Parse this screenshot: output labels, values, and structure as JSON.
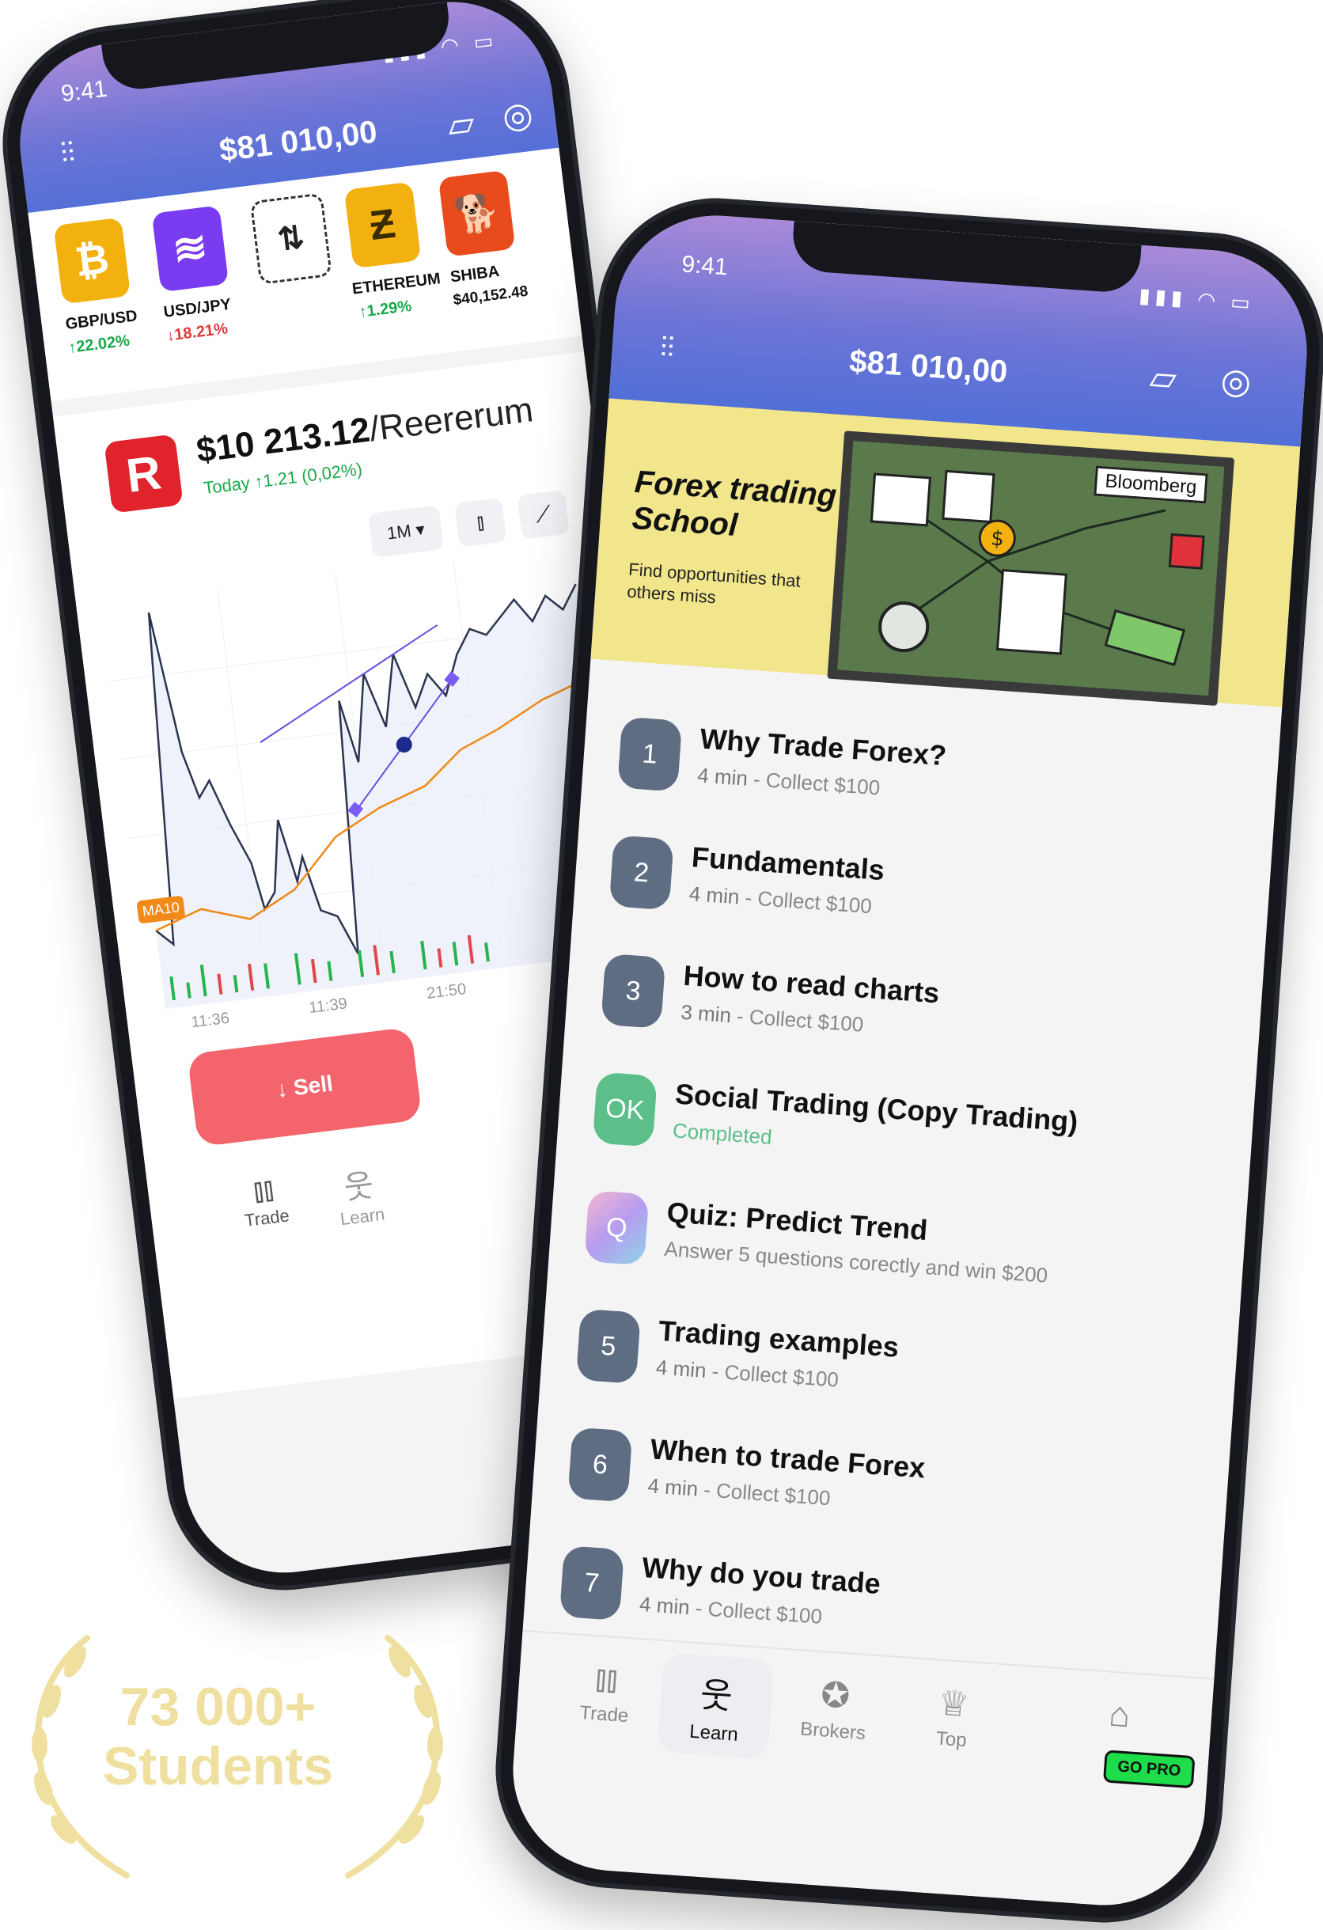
{
  "left_phone": {
    "status_time": "9:41",
    "balance": "$81 010,00",
    "coins": [
      {
        "pair": "GBP/USD",
        "change": "↑22.02%",
        "dir": "up",
        "color": "#f3b10f",
        "glyph": "₿"
      },
      {
        "pair": "USD/JPY",
        "change": "↓18.21%",
        "dir": "down",
        "color": "#7a3cf0",
        "glyph": "≋"
      },
      {
        "pair": "",
        "change": "",
        "dir": "",
        "color": "#ffffff",
        "glyph": "⇅"
      },
      {
        "pair": "ETHEREUM",
        "change": "↑1.29%",
        "dir": "up",
        "color": "#f3b10f",
        "glyph": "Ƶ"
      },
      {
        "pair": "SHIBA",
        "change": "$40,152.48",
        "dir": "",
        "color": "#e84b1c",
        "glyph": "🐕"
      }
    ],
    "asset_logo": "R",
    "price": "$10 213.12",
    "price_name": "/Reererum",
    "today": "Today  ↑1.21 (0,02%)",
    "timeframe": "1M ▾",
    "ma_label": "MA10",
    "time_labels": [
      "11:36",
      "11:39",
      "21:50"
    ],
    "sell_label": "↓  Sell",
    "nav": [
      {
        "label": "Trade",
        "icon": "candles-icon"
      },
      {
        "label": "Learn",
        "icon": "learn-icon"
      }
    ]
  },
  "right_phone": {
    "status_time": "9:41",
    "balance": "$81 010,00",
    "banner": {
      "title_line1": "Forex trading",
      "title_line2": "School",
      "subtitle": "Find opportunities that others miss",
      "board_tag": "Bloomberg"
    },
    "lessons": [
      {
        "badge": "1",
        "title": "Why Trade Forex?",
        "meta_time": "4 min",
        "meta_reward": " - Collect $100",
        "state": "locked"
      },
      {
        "badge": "2",
        "title": "Fundamentals",
        "meta_time": "4 min",
        "meta_reward": " - Collect $100",
        "state": "locked"
      },
      {
        "badge": "3",
        "title": "How to read charts",
        "meta_time": "3 min",
        "meta_reward": " - Collect $100",
        "state": "locked"
      },
      {
        "badge": "OK",
        "title": "Social Trading (Copy Trading)",
        "meta_time": "Completed",
        "meta_reward": "",
        "state": "completed"
      },
      {
        "badge": "Q",
        "title": "Quiz: Predict Trend",
        "meta_time": "Answer 5 questions corectly and win $200",
        "meta_reward": "",
        "state": "quiz"
      },
      {
        "badge": "5",
        "title": "Trading examples",
        "meta_time": "4 min",
        "meta_reward": " - Collect $100",
        "state": "locked"
      },
      {
        "badge": "6",
        "title": "When to trade Forex",
        "meta_time": "4 min",
        "meta_reward": " - Collect $100",
        "state": "locked"
      },
      {
        "badge": "7",
        "title": "Why do you trade",
        "meta_time": "4 min",
        "meta_reward": " - Collect $100",
        "state": "locked"
      }
    ],
    "nav": [
      {
        "label": "Trade",
        "icon": "candles-icon"
      },
      {
        "label": "Learn",
        "icon": "learn-icon"
      },
      {
        "label": "Brokers",
        "icon": "medal-icon"
      },
      {
        "label": "Top",
        "icon": "trophy-icon"
      },
      {
        "label": "",
        "icon": "store-icon"
      }
    ],
    "go_pro": "GO PRO"
  },
  "badge": {
    "line1": "73 000+",
    "line2": "Students"
  },
  "colors": {
    "sell": "#f4646d",
    "up": "#18a84a",
    "down": "#e03a3a",
    "header_top": "#a98ad8",
    "header_bottom": "#4f6fd8",
    "banner": "#f2e68c",
    "completed": "#5cbf8a"
  }
}
